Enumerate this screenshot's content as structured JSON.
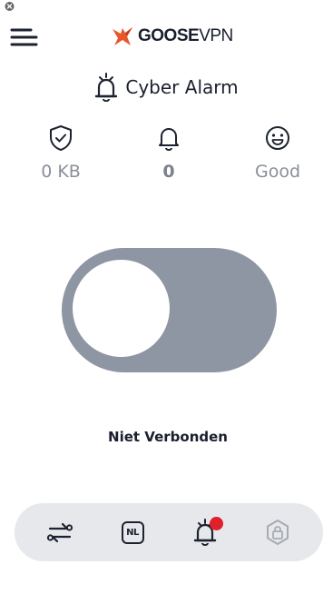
{
  "app": {
    "brand_bold": "GOOSE",
    "brand_light": "VPN",
    "page_title": "Cyber Alarm"
  },
  "stats": [
    {
      "icon": "shield-check-icon",
      "value": "0 KB"
    },
    {
      "icon": "bell-icon",
      "value": "0"
    },
    {
      "icon": "smiley-icon",
      "value": "Good"
    }
  ],
  "connection": {
    "connected": false,
    "status_label": "Niet Verbonden"
  },
  "bottom_nav": {
    "items": [
      {
        "icon": "switch-arrows-icon"
      },
      {
        "icon": "country-badge-icon",
        "label": "NL"
      },
      {
        "icon": "alarm-bell-icon",
        "has_notification": true
      },
      {
        "icon": "lock-hexagon-icon"
      }
    ]
  },
  "colors": {
    "toggle_off": "#8e95a3",
    "nav_bg": "#e7e8ec",
    "logo_orange": "#e8572a",
    "notification_red": "#e0202d",
    "stat_text": "#8a8f99"
  }
}
